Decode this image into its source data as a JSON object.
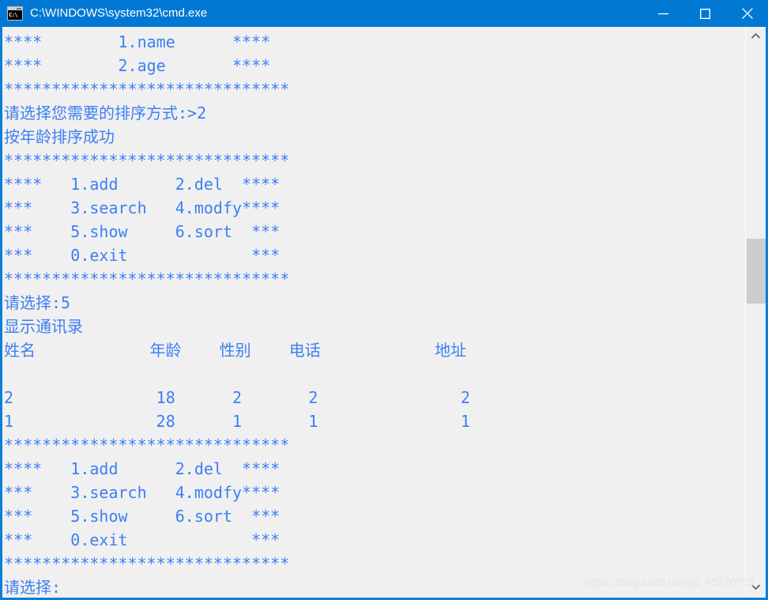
{
  "window": {
    "title": "C:\\WINDOWS\\system32\\cmd.exe",
    "icon_text": "C:\\",
    "accent_color": "#0078d4",
    "border_color": "#0d7fd4",
    "controls": [
      {
        "name": "minimize",
        "glyph": "—"
      },
      {
        "name": "maximize",
        "glyph": "□"
      },
      {
        "name": "close",
        "glyph": "✕"
      }
    ]
  },
  "console": {
    "background_color": "#f0f0f0",
    "text_color": "#3d7ff4",
    "lines": [
      "****        1.name      ****",
      "****        2.age       ****",
      "******************************",
      "请选择您需要的排序方式:>2",
      "按年龄排序成功",
      "******************************",
      "****   1.add      2.del  ****",
      "***    3.search   4.modfy****",
      "***    5.show     6.sort  ***",
      "***    0.exit             ***",
      "******************************",
      "请选择:5",
      "显示通讯录",
      "姓名            年龄    性别    电话            地址",
      "",
      "2               18      2       2               2",
      "1               28      1       1               1",
      "******************************",
      "****   1.add      2.del  ****",
      "***    3.search   4.modfy****",
      "***    5.show     6.sort  ***",
      "***    0.exit             ***",
      "******************************",
      "请选择:"
    ],
    "table": {
      "headers": [
        "姓名",
        "年龄",
        "性别",
        "电话",
        "地址"
      ],
      "rows": [
        [
          "2",
          "18",
          "2",
          "2",
          "2"
        ],
        [
          "1",
          "28",
          "1",
          "1",
          "1"
        ]
      ]
    },
    "menu": {
      "items": [
        "1.add",
        "2.del",
        "3.search",
        "4.modfy",
        "5.show",
        "6.sort",
        "0.exit"
      ]
    },
    "sort_menu": {
      "items": [
        "1.name",
        "2.age"
      ]
    },
    "prompts": {
      "sort_prompt": "请选择您需要的排序方式:>2",
      "sort_success": "按年龄排序成功",
      "choice_5": "请选择:5",
      "show_contacts": "显示通讯录",
      "choice_empty": "请选择:"
    }
  },
  "scrollbar": {
    "up_arrow": "chevron-up",
    "down_arrow": "chevron-down",
    "thumb_color": "#cdcdcd"
  },
  "watermark": {
    "text": "https://blog.csdn.net/qq_45270753"
  }
}
